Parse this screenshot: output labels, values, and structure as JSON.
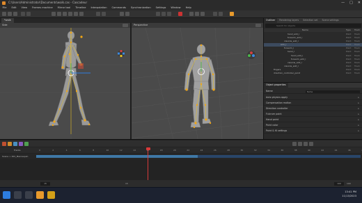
{
  "window": {
    "title": "C:\\Users\\Administrator\\Documents\\walk.cas - Cascadeur",
    "controls": [
      "—",
      "□",
      "✕"
    ]
  },
  "menu": [
    "File",
    "Edit",
    "View",
    "Frames machine",
    "Mirror tool",
    "Timeline",
    "Interpolation",
    "Commands",
    "Synchronization",
    "Settings",
    "Window",
    "Help"
  ],
  "doc_tab": "*walk",
  "viewports": {
    "left_label": "Side",
    "right_label": "Perspective"
  },
  "outliner": {
    "tabs": [
      "Outliner",
      "Rendering layers",
      "Selection set",
      "Scene settings",
      "Quick rigging tool"
    ],
    "search_placeholder": "Search for objects",
    "columns": {
      "name": "Name",
      "type": "Type",
      "track": "Track"
    },
    "rows": [
      {
        "name": "hand_add_l",
        "indent": 6,
        "type": "Point",
        "track": "Track"
      },
      {
        "name": "forearm_add_l",
        "indent": 6,
        "type": "Point",
        "track": "Track"
      },
      {
        "name": "clavicle_add_l",
        "indent": 5,
        "type": "Point",
        "track": "Track"
      },
      {
        "name": "arm_l",
        "indent": 4,
        "type": "Point",
        "track": "Track"
      },
      {
        "name": "forearm_l",
        "indent": 5,
        "type": "Point",
        "track": "Track"
      },
      {
        "name": "hand_l",
        "indent": 6,
        "type": "Point",
        "track": "Track"
      },
      {
        "name": "hand_add_l",
        "indent": 7,
        "type": "Point",
        "track": "Track"
      },
      {
        "name": "forearm_add_l",
        "indent": 7,
        "type": "Point",
        "track": "Track"
      },
      {
        "name": "clavicle_add_l",
        "indent": 6,
        "type": "Point",
        "track": "Track"
      },
      {
        "name": "clavicle_add_l",
        "indent": 5,
        "type": "Point",
        "track": "Track"
      },
      {
        "name": "fingers",
        "indent": 2,
        "type": "Point",
        "track": "Track"
      },
      {
        "name": "direction_controller_point",
        "indent": 2,
        "type": "Point",
        "track": "Track"
      }
    ]
  },
  "properties": {
    "header": "Object properties",
    "name_label": "Name",
    "name_value": "Name",
    "sections": [
      "Auto physics apply",
      "Compensation motion",
      "Direction controller",
      "Fulcrum point",
      "Hand point",
      "Point color",
      "Point & IK settings"
    ]
  },
  "timeline": {
    "tracks_label": "Tracks",
    "track_name": "Scene > 001_Mannequin",
    "ruler_ticks": [
      "0",
      "2",
      "4",
      "6",
      "8",
      "10",
      "12",
      "14",
      "16",
      "18",
      "20",
      "22",
      "24",
      "26",
      "28",
      "30",
      "32",
      "34",
      "36",
      "38",
      "40",
      "42",
      "44",
      "46",
      "48"
    ],
    "current_frame": "15",
    "end_frame": "100",
    "speed": "100"
  },
  "taskbar": {
    "time": "13:41 PM",
    "date": "11/13/2023"
  },
  "colors": {
    "accent_orange": "#e89a2c",
    "selection_blue": "#3f78a6",
    "playhead": "#d83a3a"
  }
}
